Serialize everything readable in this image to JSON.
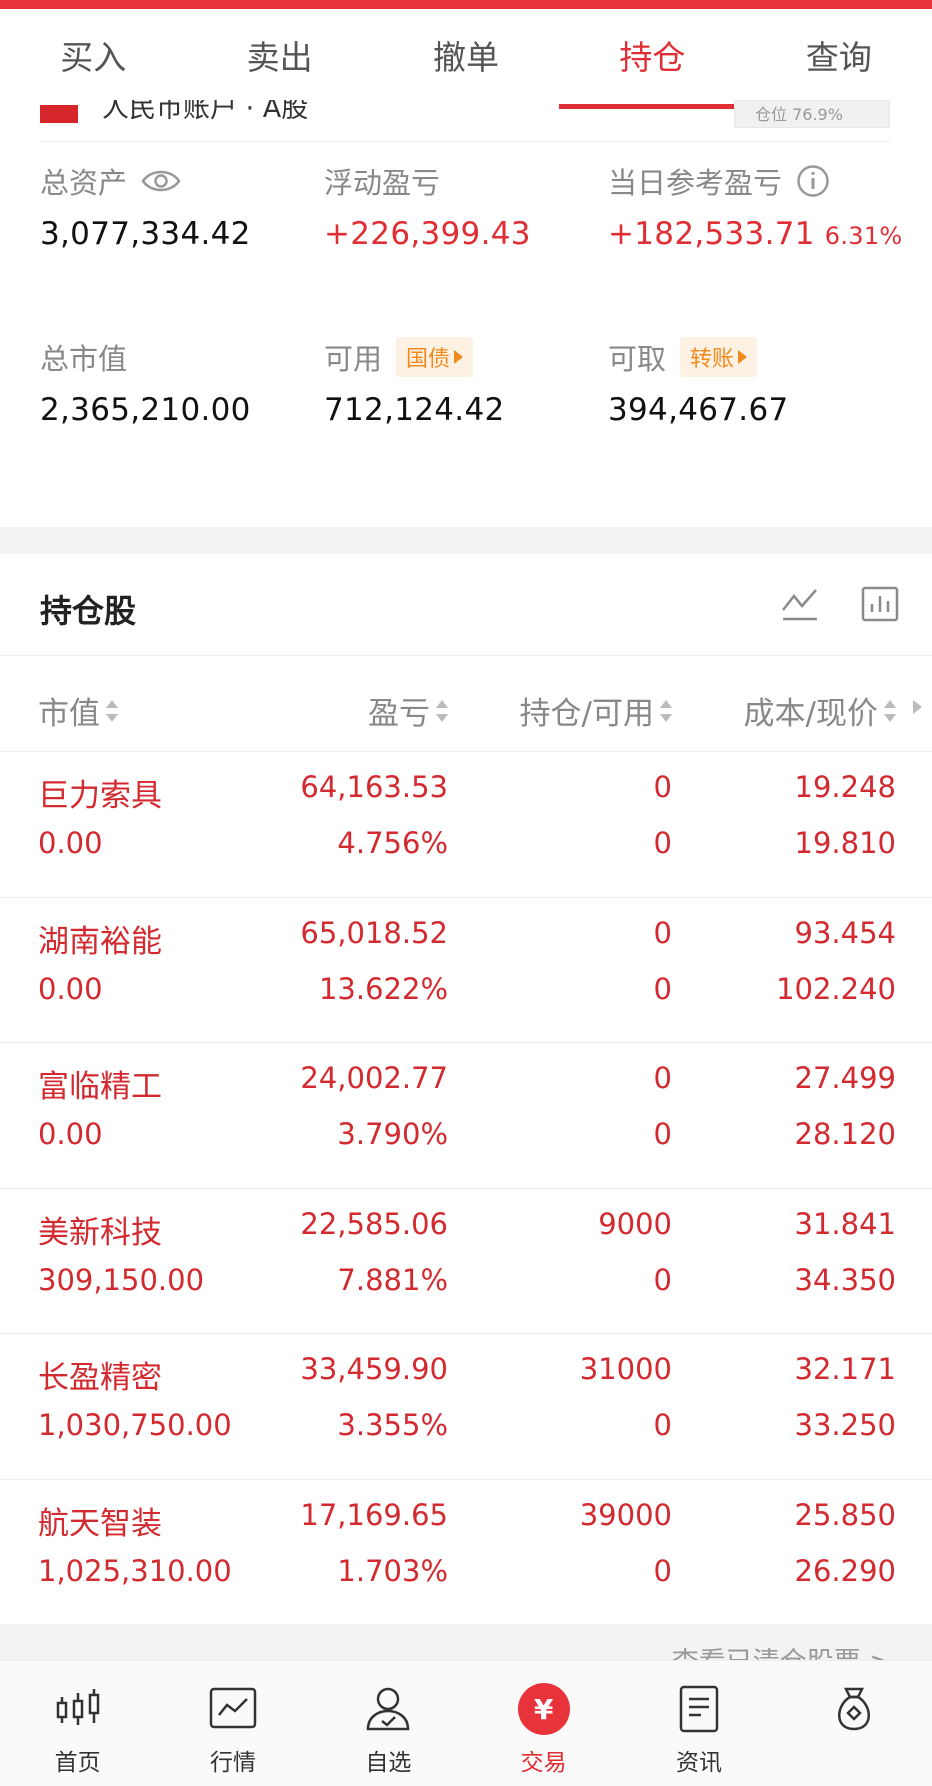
{
  "tabs": [
    {
      "label": "买入",
      "active": false
    },
    {
      "label": "卖出",
      "active": false
    },
    {
      "label": "撤单",
      "active": false
    },
    {
      "label": "持仓",
      "active": true
    },
    {
      "label": "查询",
      "active": false
    }
  ],
  "account": {
    "label": "人民币账户 · A股",
    "pill": "仓位 76.9%"
  },
  "summary": {
    "total_assets": {
      "label": "总资产",
      "value": "3,077,334.42"
    },
    "floating_pl": {
      "label": "浮动盈亏",
      "value": "+226,399.43"
    },
    "daily_pl": {
      "label": "当日参考盈亏",
      "value": "+182,533.71",
      "pct": "6.31%"
    },
    "market_value": {
      "label": "总市值",
      "value": "2,365,210.00"
    },
    "available": {
      "label": "可用",
      "tag": "国债",
      "value": "712,124.42"
    },
    "withdrawable": {
      "label": "可取",
      "tag": "转账",
      "value": "394,467.67"
    }
  },
  "holdings_section": {
    "title": "持仓股"
  },
  "columns": {
    "market_value": "市值",
    "pl": "盈亏",
    "position": "持仓/可用",
    "cost": "成本/现价"
  },
  "holdings": [
    {
      "name": "巨力索具",
      "market_value": "0.00",
      "pl": "64,163.53",
      "pl_ratio": "4.756%",
      "position": "0",
      "available": "0",
      "cost": "19.248",
      "price": "19.810"
    },
    {
      "name": "湖南裕能",
      "market_value": "0.00",
      "pl": "65,018.52",
      "pl_ratio": "13.622%",
      "position": "0",
      "available": "0",
      "cost": "93.454",
      "price": "102.240"
    },
    {
      "name": "富临精工",
      "market_value": "0.00",
      "pl": "24,002.77",
      "pl_ratio": "3.790%",
      "position": "0",
      "available": "0",
      "cost": "27.499",
      "price": "28.120"
    },
    {
      "name": "美新科技",
      "market_value": "309,150.00",
      "pl": "22,585.06",
      "pl_ratio": "7.881%",
      "position": "9000",
      "available": "0",
      "cost": "31.841",
      "price": "34.350"
    },
    {
      "name": "长盈精密",
      "market_value": "1,030,750.00",
      "pl": "33,459.90",
      "pl_ratio": "3.355%",
      "position": "31000",
      "available": "0",
      "cost": "32.171",
      "price": "33.250"
    },
    {
      "name": "航天智装",
      "market_value": "1,025,310.00",
      "pl": "17,169.65",
      "pl_ratio": "1.703%",
      "position": "39000",
      "available": "0",
      "cost": "25.850",
      "price": "26.290"
    }
  ],
  "footer_link": "查看已清仓股票 >",
  "nav": [
    {
      "label": "首页",
      "icon": "candlestick-icon",
      "active": false
    },
    {
      "label": "行情",
      "icon": "trend-chart-icon",
      "active": false
    },
    {
      "label": "自选",
      "icon": "user-check-icon",
      "active": false
    },
    {
      "label": "交易",
      "icon": "yuan-icon",
      "active": true,
      "glyph": "¥"
    },
    {
      "label": "资讯",
      "icon": "document-icon",
      "active": false
    },
    {
      "label": "",
      "icon": "money-bag-icon",
      "active": false
    }
  ],
  "colors": {
    "brand_red": "#e02e35",
    "tag_orange": "#f08a1d"
  }
}
